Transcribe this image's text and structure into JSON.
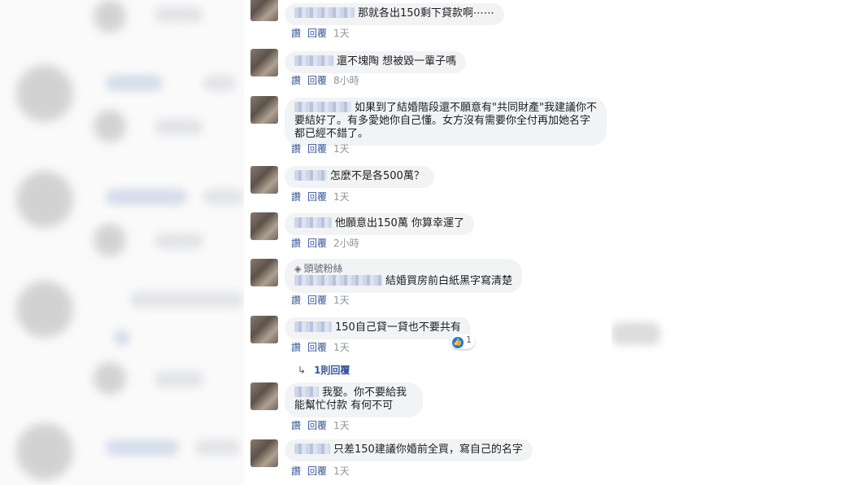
{
  "actions": {
    "like": "讚",
    "reply": "回覆"
  },
  "comments": [
    {
      "text": "那就各出150剩下貸款啊⋯⋯",
      "time": "1天"
    },
    {
      "text": "還不塊陶 想被毀一輩子嗎",
      "time": "8小時"
    },
    {
      "text": "如果到了結婚階段還不願意有\"共同財產\"我建議你不要結好了。有多愛她你自己懂。女方沒有需要你全付再加她名字都已經不錯了。",
      "time": "1天"
    },
    {
      "text": "怎麼不是各500萬？",
      "time": "1天"
    },
    {
      "text": "他願意出150萬 你算幸運了",
      "time": "2小時"
    },
    {
      "badge": "頭號粉絲",
      "text": "結婚買房前白紙黑字寫清楚",
      "time": "1天"
    },
    {
      "text": "150自己貸一貸也不要共有",
      "time": "1天",
      "reaction_count": "1",
      "replies_label": "1則回覆"
    },
    {
      "text": "我娶。你不要給我\n能幫忙付款 有何不可",
      "time": "1天"
    },
    {
      "text": "只差150建議你婚前全買，寫自己的名字",
      "time": "1天"
    }
  ]
}
